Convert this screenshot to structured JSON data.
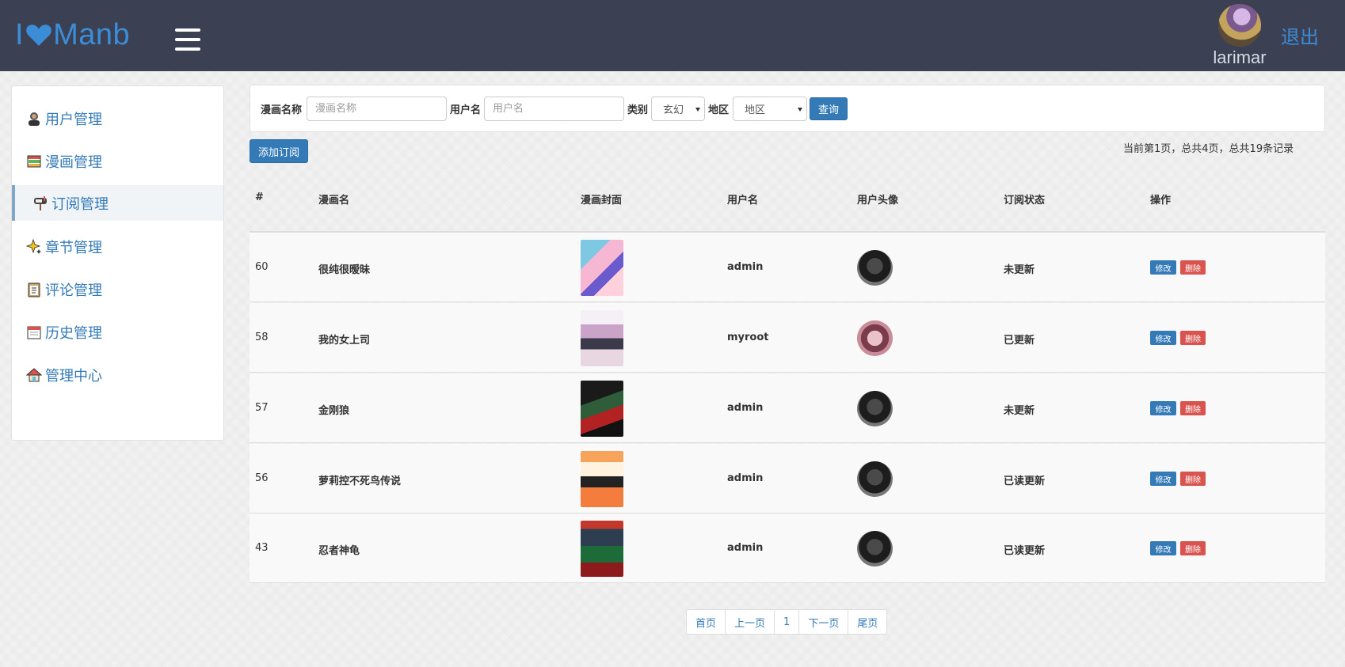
{
  "header": {
    "logo_left": "I",
    "logo_right": "Manb",
    "username": "larimar",
    "logout_label": "退出"
  },
  "sidebar": {
    "items": [
      {
        "label": "用户管理",
        "icon": "user-icon"
      },
      {
        "label": "漫画管理",
        "icon": "books-icon"
      },
      {
        "label": "订阅管理",
        "icon": "mailbox-icon",
        "active": true
      },
      {
        "label": "章节管理",
        "icon": "sparkle-icon"
      },
      {
        "label": "评论管理",
        "icon": "clipboard-icon"
      },
      {
        "label": "历史管理",
        "icon": "calendar-icon"
      },
      {
        "label": "管理中心",
        "icon": "house-icon"
      }
    ]
  },
  "search": {
    "comic_label": "漫画名称",
    "comic_placeholder": "漫画名称",
    "user_label": "用户名",
    "user_placeholder": "用户名",
    "category_label": "类别",
    "category_value": "玄幻",
    "region_label": "地区",
    "region_value": "地区",
    "query_label": "查询"
  },
  "actions": {
    "add_label": "添加订阅"
  },
  "page_info": "当前第1页，总共4页，总共19条记录",
  "table": {
    "columns": [
      "#",
      "漫画名",
      "漫画封面",
      "用户名",
      "用户头像",
      "订阅状态",
      "操作"
    ],
    "edit_label": "修改",
    "delete_label": "删除",
    "rows": [
      {
        "id": "60",
        "comic": "很纯很暧昧",
        "username": "admin",
        "status": "未更新"
      },
      {
        "id": "58",
        "comic": "我的女上司",
        "username": "myroot",
        "status": "已更新"
      },
      {
        "id": "57",
        "comic": "金刚狼",
        "username": "admin",
        "status": "未更新"
      },
      {
        "id": "56",
        "comic": "萝莉控不死鸟传说",
        "username": "admin",
        "status": "已读更新"
      },
      {
        "id": "43",
        "comic": "忍者神龟",
        "username": "admin",
        "status": "已读更新"
      }
    ]
  },
  "pagination": {
    "first": "首页",
    "prev": "上一页",
    "current": "1",
    "next": "下一页",
    "last": "尾页"
  },
  "colors": {
    "topbar": "#3b4152",
    "accent": "#337ab7",
    "danger": "#d9534f"
  }
}
